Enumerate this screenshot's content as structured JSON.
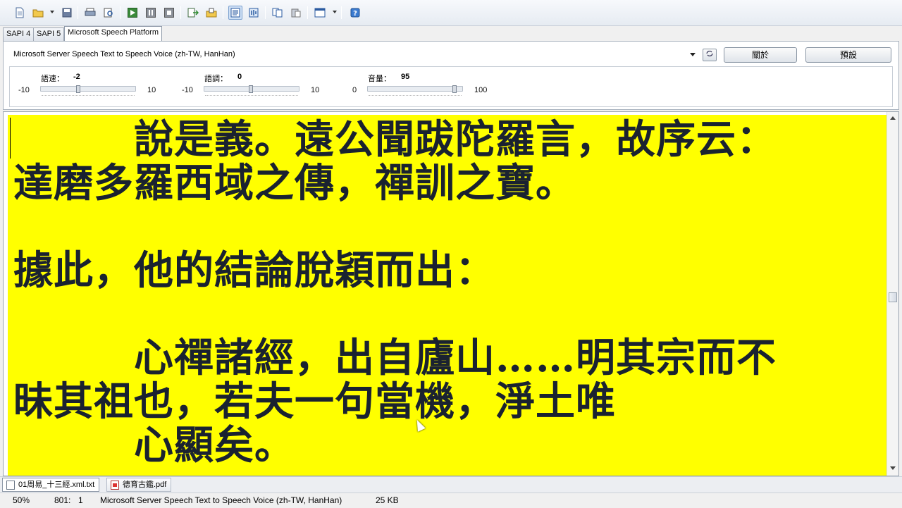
{
  "toolbar": {
    "icons": [
      "new-file-icon",
      "open-folder-icon",
      "save-icon",
      "print-icon",
      "print-preview-icon",
      "play-icon",
      "pause-icon",
      "stop-icon",
      "export-icon",
      "import-icon",
      "text-view-icon",
      "speech-settings-icon",
      "copy-icon",
      "paste-icon",
      "window-icon",
      "help-icon"
    ]
  },
  "tabs": [
    {
      "label": "SAPI 4",
      "active": false
    },
    {
      "label": "SAPI 5",
      "active": false
    },
    {
      "label": "Microsoft Speech Platform",
      "active": true
    }
  ],
  "voice": {
    "selected": "Microsoft Server Speech Text to Speech Voice (zh-TW, HanHan)",
    "about_label": "關於",
    "default_label": "預設"
  },
  "controls": {
    "rate": {
      "label": "語速：",
      "value": "-2",
      "min": "-10",
      "max": "10",
      "fraction": 0.4
    },
    "pitch": {
      "label": "語調：",
      "value": "0",
      "min": "-10",
      "max": "10",
      "fraction": 0.5
    },
    "volume": {
      "label": "音量：",
      "value": "95",
      "min": "0",
      "max": "100",
      "fraction": 0.95
    }
  },
  "document": {
    "lines": [
      "　　　說是義。遠公聞跋陀羅言，故序云：",
      "達磨多羅西域之傳，禪訓之寶。",
      "",
      "據此，他的結論脫穎而出：",
      "",
      "　　　心禪諸經，出自廬山……明其宗而不",
      "昧其祖也，若夫一句當機，淨土唯",
      "　　　心顯矣。"
    ],
    "background": "#ffff00",
    "text_color": "#1a2230"
  },
  "doc_tabs": [
    {
      "label": "01周易_十三經.xml.txt",
      "active": true,
      "icon": "text-file-icon"
    },
    {
      "label": "德育古鑑.pdf",
      "active": false,
      "icon": "pdf-file-icon"
    }
  ],
  "status": {
    "zoom": "50%",
    "position": "801:",
    "column": "1",
    "voice": "Microsoft Server Speech Text to Speech Voice (zh-TW, HanHan)",
    "size": "25 KB"
  }
}
